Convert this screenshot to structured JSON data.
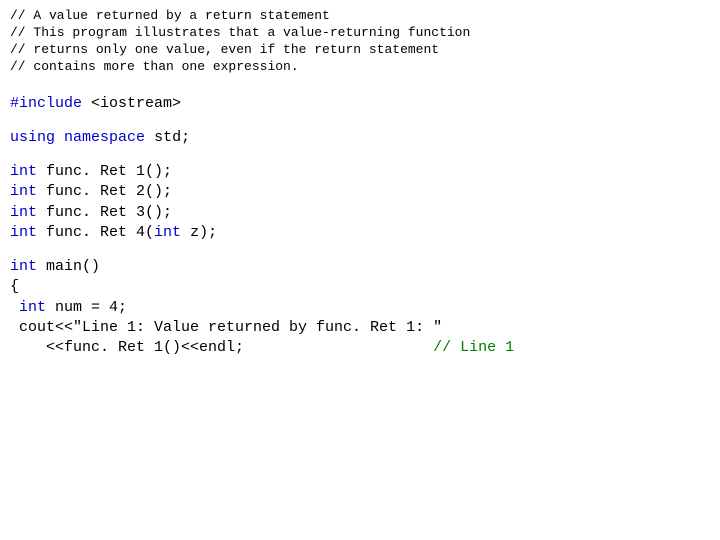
{
  "comments": {
    "l1": "// A value returned by a return statement",
    "l2": "// This program illustrates that a value-returning function",
    "l3": "// returns only one value, even if the return statement",
    "l4": "// contains more than one expression."
  },
  "include": {
    "kw": "#include",
    "lt": " <",
    "hdr": "iostream",
    "gt": ">"
  },
  "using": {
    "kw_using": "using",
    "sp1": " ",
    "kw_ns": "namespace",
    "sp2": " ",
    "name": "std",
    "semi": ";"
  },
  "protos": {
    "int_kw": "int",
    "p1": " func. Ret 1();",
    "p2": " func. Ret 2();",
    "p3": " func. Ret 3();",
    "p4a": " func. Ret 4(",
    "p4_int": "int",
    "p4b": " z);"
  },
  "main": {
    "int_kw": "int",
    "main_decl": " main()",
    "brace": "{",
    "decl_pre": " ",
    "decl_int": "int",
    "decl_rest": " num = 4;",
    "cout1": " cout<<\"Line 1: Value returned by func. Ret 1: \"",
    "cout2a": "    <<func. Ret 1()<<endl;",
    "cout2_gap": "                     ",
    "cout2_comment": "// Line 1"
  }
}
